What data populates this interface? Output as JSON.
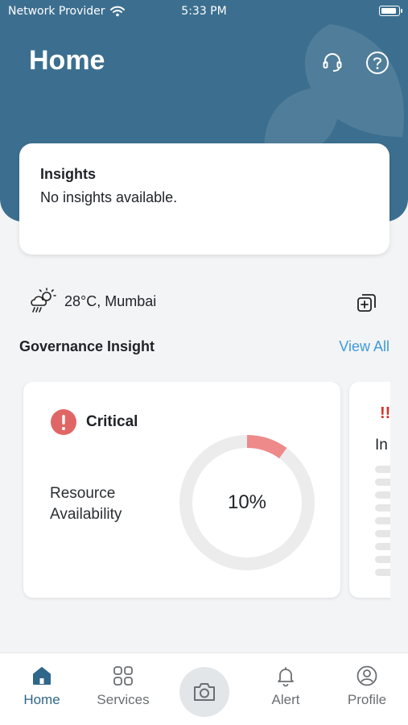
{
  "status_bar": {
    "carrier": "Network Provider",
    "time": "5:33 PM"
  },
  "header": {
    "title": "Home",
    "icons": [
      "headset-icon",
      "help-icon"
    ]
  },
  "insights": {
    "title": "Insights",
    "body": "No insights available."
  },
  "weather": {
    "icon": "rain-sun-icon",
    "text": "28°C, Mumbai"
  },
  "governance": {
    "title": "Governance Insight",
    "view_all": "View All",
    "cards": [
      {
        "status": "Critical",
        "metric": "Resource Availability",
        "value_text": "10%",
        "value": 10,
        "accent_color": "#ee8a8a"
      },
      {
        "status_icon": "double-exclamation-icon",
        "status_mark": "!!",
        "partial_text": "In"
      }
    ]
  },
  "tabs": [
    {
      "label": "Home",
      "icon": "home-icon",
      "active": true
    },
    {
      "label": "Services",
      "icon": "grid-icon",
      "active": false
    },
    {
      "label": "",
      "icon": "camera-icon",
      "active": false
    },
    {
      "label": "Alert",
      "icon": "bell-icon",
      "active": false
    },
    {
      "label": "Profile",
      "icon": "user-circle-icon",
      "active": false
    }
  ],
  "colors": {
    "header": "#3c6f8f",
    "link": "#3d9bd6",
    "critical": "#e06666",
    "active_tab": "#2f668a"
  }
}
